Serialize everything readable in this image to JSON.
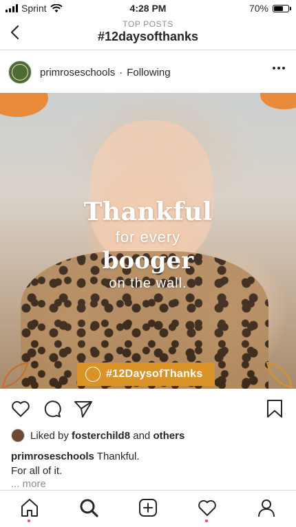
{
  "status_bar": {
    "carrier": "Sprint",
    "time": "4:28 PM",
    "battery": "70%",
    "battery_level": 0.7
  },
  "header": {
    "eyebrow": "TOP POSTS",
    "title": "#12daysofthanks"
  },
  "post": {
    "username": "primroseschools",
    "separator": "·",
    "follow_status": "Following",
    "image": {
      "text_line1": "Thankful",
      "text_line2": "for every",
      "text_line3": "booger",
      "text_line4": "on the wall.",
      "hashtag": "#12DaysofThanks"
    },
    "likes": {
      "prefix": "Liked by",
      "user": "fosterchild8",
      "conjunction": "and",
      "others": "others"
    },
    "caption": {
      "username": "primroseschools",
      "text_line1": "Thankful.",
      "text_line2": "For all of it."
    },
    "more_label": "... more"
  },
  "colors": {
    "accent_orange": "#d99326",
    "notification_dot": "#ed4956",
    "pumpkin": "#e88a3a"
  },
  "icons": [
    "back-chevron-icon",
    "more-dots-icon",
    "heart-icon",
    "comment-icon",
    "share-icon",
    "bookmark-icon",
    "home-icon",
    "search-icon",
    "add-icon",
    "activity-heart-icon",
    "profile-icon"
  ]
}
